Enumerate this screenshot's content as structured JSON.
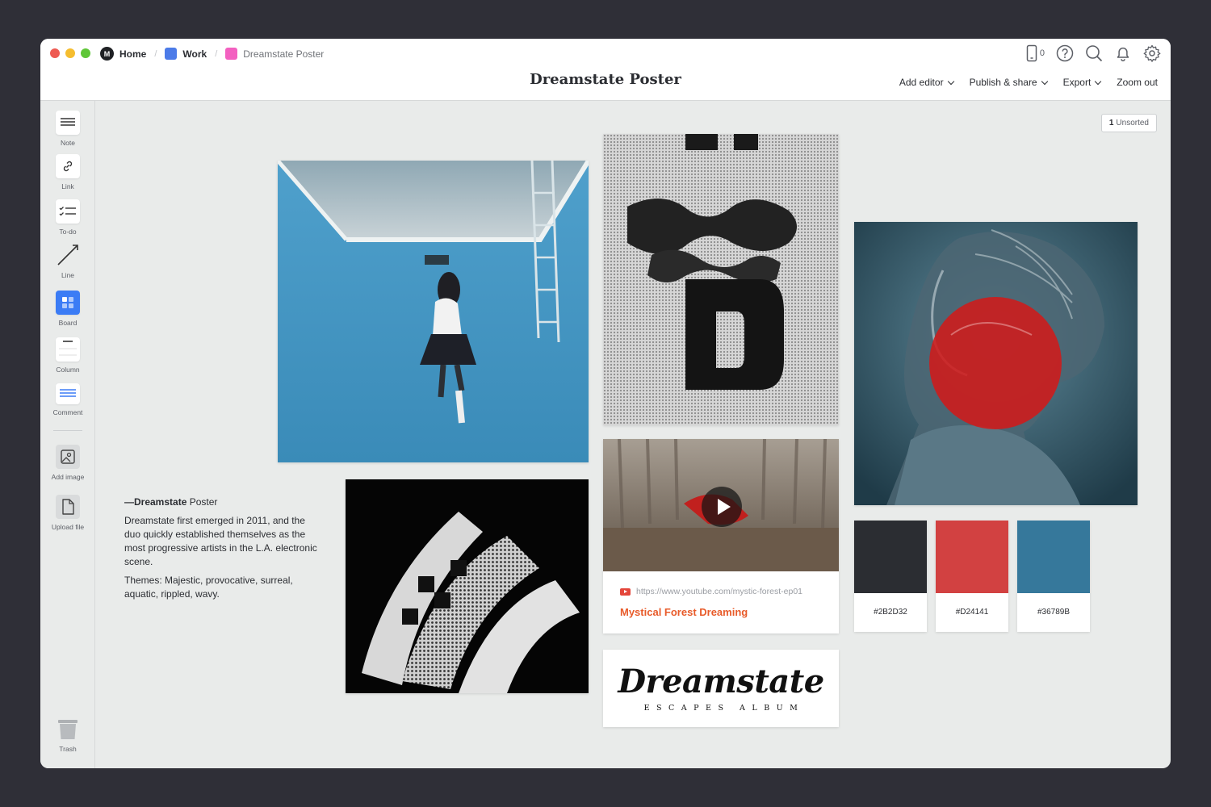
{
  "breadcrumbs": [
    {
      "label": "Home",
      "color": "#1f2124"
    },
    {
      "label": "Work",
      "color": "#4c7be8"
    },
    {
      "label": "Dreamstate Poster",
      "color": "#f360c0"
    }
  ],
  "header": {
    "title": "Dreamstate Poster",
    "device_count": "0",
    "icons": [
      "mobile-icon",
      "help-icon",
      "search-icon",
      "bell-icon",
      "gear-icon"
    ],
    "menu": {
      "add_editor": "Add editor",
      "publish_share": "Publish & share",
      "export": "Export",
      "zoom_out": "Zoom out"
    }
  },
  "sidebar": {
    "tools": [
      {
        "label": "Note",
        "icon": "note-icon"
      },
      {
        "label": "Link",
        "icon": "link-icon"
      },
      {
        "label": "To-do",
        "icon": "todo-icon"
      },
      {
        "label": "Line",
        "icon": "line-icon"
      },
      {
        "label": "Board",
        "icon": "board-icon"
      },
      {
        "label": "Column",
        "icon": "column-icon"
      },
      {
        "label": "Comment",
        "icon": "comment-icon"
      },
      {
        "label": "Add image",
        "icon": "image-icon"
      },
      {
        "label": "Upload file",
        "icon": "file-icon"
      }
    ],
    "trash": "Trash"
  },
  "canvas": {
    "unsorted": {
      "count": "1",
      "label": "Unsorted"
    },
    "note": {
      "dash_title": "—Dreamstate",
      "title_rest": " Poster",
      "paragraph1": "Dreamstate first emerged in 2011, and the duo quickly established themselves as the most progressive artists in the L.A. electronic scene.",
      "paragraph2": "Themes: Majestic, provocative, surreal, aquatic, rippled, wavy."
    },
    "video": {
      "url": "https://www.youtube.com/mystic-forest-ep01",
      "title": "Mystical Forest Dreaming"
    },
    "album": {
      "title": "Dreamstate",
      "subtitle": "ESCAPES ALBUM"
    },
    "swatches": [
      {
        "hex": "#2B2D32",
        "color": "#2b2d32"
      },
      {
        "hex": "#D24141",
        "color": "#d24141"
      },
      {
        "hex": "#36789B",
        "color": "#36789b"
      }
    ]
  }
}
